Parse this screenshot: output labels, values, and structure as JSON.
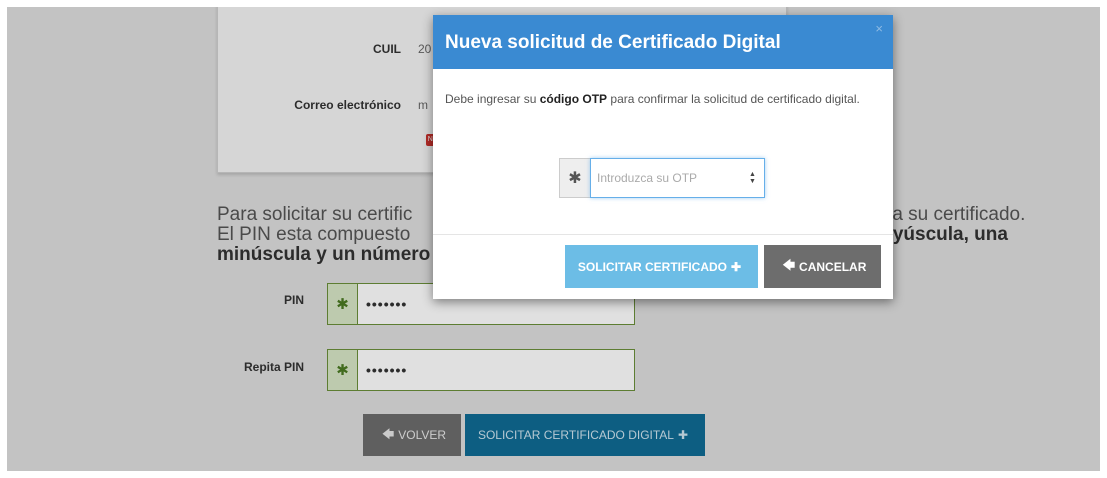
{
  "background": {
    "card": {
      "cuil_label": "CUIL",
      "cuil_value": "20",
      "email_label": "Correo electrónico",
      "email_value": "m",
      "badge": "NO"
    },
    "paragraph": {
      "line1_start": "Para solicitar su certific",
      "line1_end": "ado a su certificado.",
      "line2_start": "El PIN esta compuesto",
      "line2_end": "ayúscula, una",
      "line3": "minúscula y un número"
    },
    "pin_label": "PIN",
    "pin_value": "•••••••",
    "repeat_pin_label": "Repita PIN",
    "repeat_pin_value": "•••••••",
    "back_button": "VOLVER",
    "submit_button": "SOLICITAR CERTIFICADO DIGITAL"
  },
  "modal": {
    "title": "Nueva solicitud de Certificado Digital",
    "close": "×",
    "text_before": "Debe ingresar su ",
    "text_bold": "código OTP",
    "text_after": " para confirmar la solicitud de certificado digital.",
    "otp_placeholder": "Introduzca su OTP",
    "otp_value": "",
    "required_marker": "*",
    "solicitar_button": "SOLICITAR CERTIFICADO",
    "cancelar_button": "CANCELAR"
  },
  "icons": {
    "plus": "✚",
    "arrow_left": "🡄",
    "asterisk": "✱"
  },
  "colors": {
    "modal_header": "#3a8ad2",
    "solicitar": "#6cbde6",
    "cancelar": "#6d6d6d",
    "submit_bg": "#0f6c95"
  }
}
